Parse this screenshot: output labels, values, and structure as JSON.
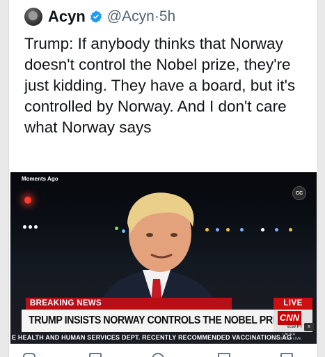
{
  "author": {
    "name": "Acyn",
    "handle": "@Acyn",
    "separator": "·",
    "time": "5h",
    "verified_color": "#1d9bf0"
  },
  "tweet": {
    "text": "Trump: If anybody thinks that Norway doesn't control the Nobel prize, they're just kidding. They have a board, but it's controlled by Norway. And I don't care what Norway says"
  },
  "video": {
    "moments_label": "Moments Ago",
    "cc_label": "CC",
    "breaking_label": "BREAKING NEWS",
    "live_label": "LIVE",
    "headline": "TRUMP INSISTS NORWAY CONTROLS THE NOBEL PRIZE",
    "network": "CNN",
    "clock": "8:50 PT",
    "mute_label": "x",
    "ticker": "E HEALTH AND HUMAN SERVICES DEPT. RECENTLY RECOMMENDED VACCINATIONS AG",
    "ticker_tag": "LAURA COATES LIVE",
    "accent_red": "#cc1010"
  },
  "actions": [
    "reply-icon",
    "repost-icon",
    "like-icon",
    "views-icon",
    "bookmark-icon"
  ]
}
